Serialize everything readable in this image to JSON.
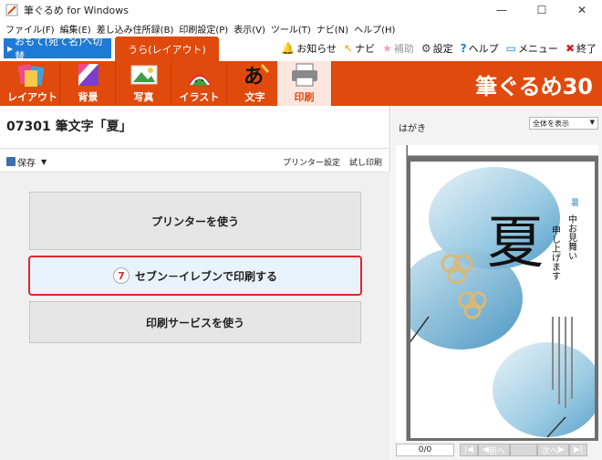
{
  "window": {
    "title": "筆ぐるめ for Windows",
    "minimize": "—",
    "maximize": "☐",
    "close": "✕"
  },
  "menu": [
    "ファイル(F)",
    "編集(E)",
    "差し込み住所録(B)",
    "印刷設定(P)",
    "表示(V)",
    "ツール(T)",
    "ナビ(N)",
    "ヘルプ(H)"
  ],
  "tabs": {
    "omote": "おもて(宛て名)へ切替",
    "ura": "うら(レイアウト)"
  },
  "right_tools": [
    {
      "icon": "bell-icon",
      "glyph": "🔔",
      "label": "お知らせ",
      "color": "#e7a400"
    },
    {
      "icon": "navi-icon",
      "glyph": "↖",
      "label": "ナビ",
      "color": "#e7a400"
    },
    {
      "icon": "star-icon",
      "glyph": "★",
      "label": "補助",
      "color": "#f2a2b0"
    },
    {
      "icon": "gear-icon",
      "glyph": "⚙",
      "label": "設定",
      "color": "#444444"
    },
    {
      "icon": "help-icon",
      "glyph": "?",
      "label": "ヘルプ",
      "color": "#1f7ad6"
    },
    {
      "icon": "menu-icon",
      "glyph": "▭",
      "label": "メニュー",
      "color": "#1f7ad6"
    },
    {
      "icon": "close-x-icon",
      "glyph": "✖",
      "label": "終了",
      "color": "#d81e1e"
    }
  ],
  "categories": [
    {
      "name": "layout",
      "label": "レイアウト",
      "active": false
    },
    {
      "name": "background",
      "label": "背景",
      "active": false
    },
    {
      "name": "photo",
      "label": "写真",
      "active": false
    },
    {
      "name": "illust",
      "label": "イラスト",
      "active": false
    },
    {
      "name": "text",
      "label": "文字",
      "active": false
    },
    {
      "name": "print",
      "label": "印刷",
      "active": true
    }
  ],
  "brand": "筆ぐるめ30",
  "document": {
    "title": "07301 筆文字「夏」"
  },
  "save": {
    "label": "保存"
  },
  "printer_links": {
    "settings": "プリンター設定",
    "test": "試し印刷"
  },
  "buttons": {
    "printer": "プリンターを使う",
    "seven": "セブン－イレブンで印刷する",
    "seven_logo": "7",
    "service": "印刷サービスを使う"
  },
  "preview": {
    "label": "はがき",
    "zoom": "全体を表示",
    "page": "0/0",
    "prev": "前へ",
    "next": "次へ",
    "card_text": {
      "calligraphy": "夏",
      "small_mark": "暑",
      "line1": "中お見舞い",
      "line2": "申し上げます"
    }
  },
  "colors": {
    "accent": "#e04a0c",
    "blue_tab": "#1f7ad6",
    "highlight": "#e0262a"
  }
}
